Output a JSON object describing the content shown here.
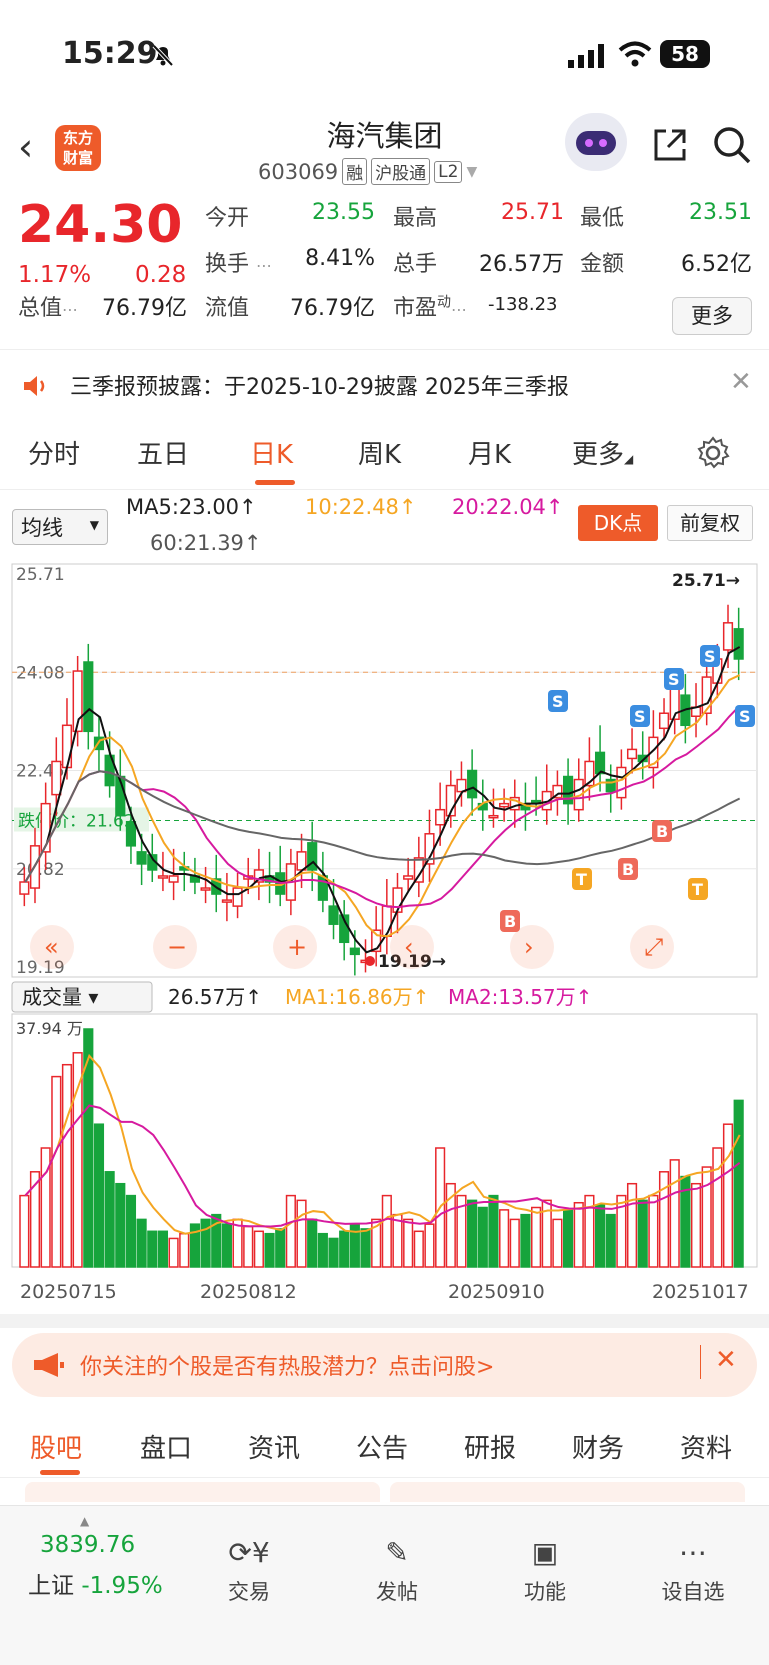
{
  "status_bar": {
    "time": "15:29",
    "battery": "58"
  },
  "header": {
    "back_icon": "chevron-left-icon",
    "logo_text": "东方\n财富",
    "title": "海汽集团",
    "code": "603069",
    "tags": [
      "融",
      "沪股通",
      "L2"
    ]
  },
  "quote": {
    "price": "24.30",
    "change_pct": "1.17%",
    "change": "0.28",
    "fields": [
      {
        "label": "今开",
        "value": "23.55",
        "color": "green"
      },
      {
        "label": "最高",
        "value": "25.71",
        "color": "red"
      },
      {
        "label": "最低",
        "value": "23.51",
        "color": "green"
      },
      {
        "label": "换手",
        "value": "8.41%",
        "color": "dark"
      },
      {
        "label": "总手",
        "value": "26.57万",
        "color": "dark"
      },
      {
        "label": "金额",
        "value": "6.52亿",
        "color": "dark"
      },
      {
        "label": "总值",
        "value": "76.79亿",
        "color": "dark"
      },
      {
        "label": "流值",
        "value": "76.79亿",
        "color": "dark"
      },
      {
        "label": "市盈",
        "value": "-138.23",
        "color": "dark"
      }
    ],
    "pe_superscript": "动",
    "more_label": "更多"
  },
  "notice": {
    "text": "三季报预披露：于2025-10-29披露 2025年三季报"
  },
  "tabs": [
    "分时",
    "五日",
    "日K",
    "周K",
    "月K",
    "更多"
  ],
  "active_tab": "日K",
  "ma": {
    "selector": "均线",
    "ma5": "MA5:23.00",
    "ma10": "10:22.48",
    "ma20": "20:22.04",
    "ma60": "60:21.39",
    "dk_label": "DK点",
    "adjust_label": "前复权"
  },
  "chart_data": {
    "type": "candlestick",
    "y_ticks": [
      "25.71",
      "24.08",
      "22.45",
      "20.82",
      "19.19"
    ],
    "ylim": [
      19.19,
      25.71
    ],
    "high_label": "25.71",
    "low_label": "19.19",
    "stop_label": "跌停价：21.62",
    "x_labels": [
      "20250715",
      "20250812",
      "20250910",
      "20251017"
    ],
    "volume": {
      "selector": "成交量",
      "current": "26.57万",
      "ma1": "MA1:16.86万",
      "ma2": "MA2:13.57万",
      "max_label": "37.94 万"
    }
  },
  "bottom_notice": {
    "text": "你关注的个股是否有热股潜力？点击问股>"
  },
  "subtabs": [
    "股吧",
    "盘口",
    "资讯",
    "公告",
    "研报",
    "财务",
    "资料"
  ],
  "footer": {
    "index_value": "3839.76",
    "index_name": "上证",
    "index_pct": "-1.95%",
    "items": [
      {
        "label": "交易",
        "icon": "yen-exchange-icon"
      },
      {
        "label": "发帖",
        "icon": "edit-icon"
      },
      {
        "label": "功能",
        "icon": "grid-icon"
      },
      {
        "label": "设自选",
        "icon": "more-dots-icon"
      }
    ]
  },
  "colors": {
    "up": "#e8262b",
    "down": "#16a43c",
    "accent": "#ee5b2a"
  }
}
